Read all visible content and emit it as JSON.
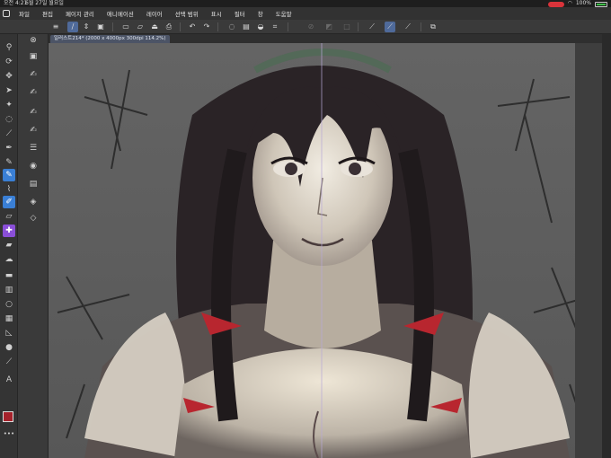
{
  "status": {
    "time": "오전 4:21",
    "date": "6월 27일 월요일",
    "battery": "100%"
  },
  "menu": [
    "파일",
    "편집",
    "페이지 관리",
    "애니메이션",
    "레이어",
    "선택 범위",
    "표시",
    "필터",
    "창",
    "도움말"
  ],
  "canvas": {
    "tab_title": "일러스트214* (2000 x 4000px 300dpi 114.2%)"
  },
  "colors": {
    "accent": "#3a7fd5",
    "main_color": "#a5222b"
  }
}
